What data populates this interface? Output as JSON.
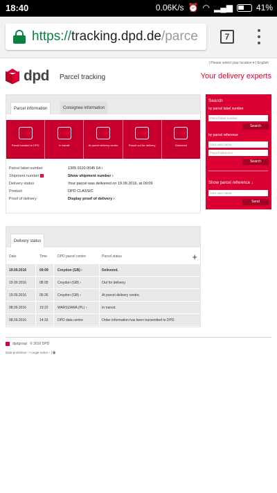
{
  "statusbar": {
    "time": "18:40",
    "speed": "0.06K/s",
    "battery": "41%"
  },
  "browser": {
    "url_scheme": "https://",
    "url_host": "tracking.dpd.de",
    "url_path": "/parce",
    "tab_count": "7"
  },
  "header": {
    "top_links": "|   Please select your location  ▾   |   English",
    "logo": "dpd",
    "page_title": "Parcel tracking",
    "tagline": "Your delivery experts"
  },
  "info_panel": {
    "tabs": [
      "Parcel information",
      "Consignee information"
    ],
    "steps": [
      "Parcel handed to DPD",
      "In transit",
      "At parcel delivery centre",
      "Parcel out for delivery",
      "Delivered"
    ],
    "fields": [
      {
        "key": "Parcel label number",
        "value": "1305 9110 0045 64 i"
      },
      {
        "key": "Shipment number",
        "value": "Show shipment number  ›"
      },
      {
        "key": "Delivery status",
        "value": "Your parcel was delivered on 19.09.2016, at 09:09"
      },
      {
        "key": "Product",
        "value": "DPD CLASSIC"
      },
      {
        "key": "Proof of delivery",
        "value": "Display proof of delivery  ›"
      }
    ],
    "badge": "i"
  },
  "sidebar": {
    "search_title": "Search",
    "by_label": "by parcel label number",
    "label_placeholder": "Parcel label number",
    "search_button": "Search",
    "by_reference": "by parcel reference",
    "user_placeholder": "Your user name",
    "reference_placeholder": "Parcel reference",
    "search_button2": "Search",
    "show_reference": "Show parcel reference  ↓",
    "user_placeholder2": "Your user name",
    "send_button": "Send"
  },
  "delivery_status": {
    "tab": "Delivery status",
    "columns": [
      "Date",
      "Time",
      "DPD parcel centre",
      "Parcel status"
    ],
    "rows": [
      {
        "date": "19.09.2016",
        "time": "09:09",
        "centre": "Croydon (GB)  ›",
        "status": "Delivered."
      },
      {
        "date": "19.09.2016",
        "time": "08:05",
        "centre": "Croydon (GB)  ›",
        "status": "Out for delivery."
      },
      {
        "date": "19.09.2016",
        "time": "05:35",
        "centre": "Croydon (GB)  ›",
        "status": "At parcel delivery centre."
      },
      {
        "date": "08.09.2016",
        "time": "19:22",
        "centre": "WARSZAWA (PL)  ›",
        "status": "In transit."
      },
      {
        "date": "08.09.2016",
        "time": "14:33",
        "centre": "DPD data centre",
        "status": "Order information has been transmitted to DPD."
      }
    ]
  },
  "footer": {
    "brand": "dpdgroup",
    "copyright": "© 2016 DPD",
    "links": "Data protection  ›   •   Legal notice  ›   |"
  },
  "colors": {
    "brand": "#dc0032",
    "url_green": "#0b8043"
  }
}
